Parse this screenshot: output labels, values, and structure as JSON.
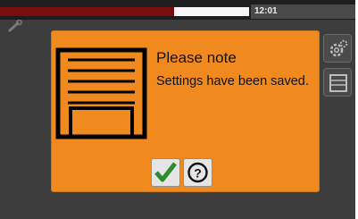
{
  "status_bar": {
    "time": "12:01",
    "progress_fraction": 0.7,
    "progress_color": "#7a0c10"
  },
  "dialog": {
    "title": "Please note",
    "message": "Settings have been saved.",
    "icon": "garage-door-icon",
    "buttons": [
      {
        "icon": "checkmark-icon",
        "color": "#2e8b2e"
      },
      {
        "icon": "help-icon"
      }
    ],
    "background_color": "#f08a1e"
  },
  "sidebar": [
    {
      "icon": "gear-icon"
    },
    {
      "icon": "door-icon"
    }
  ]
}
